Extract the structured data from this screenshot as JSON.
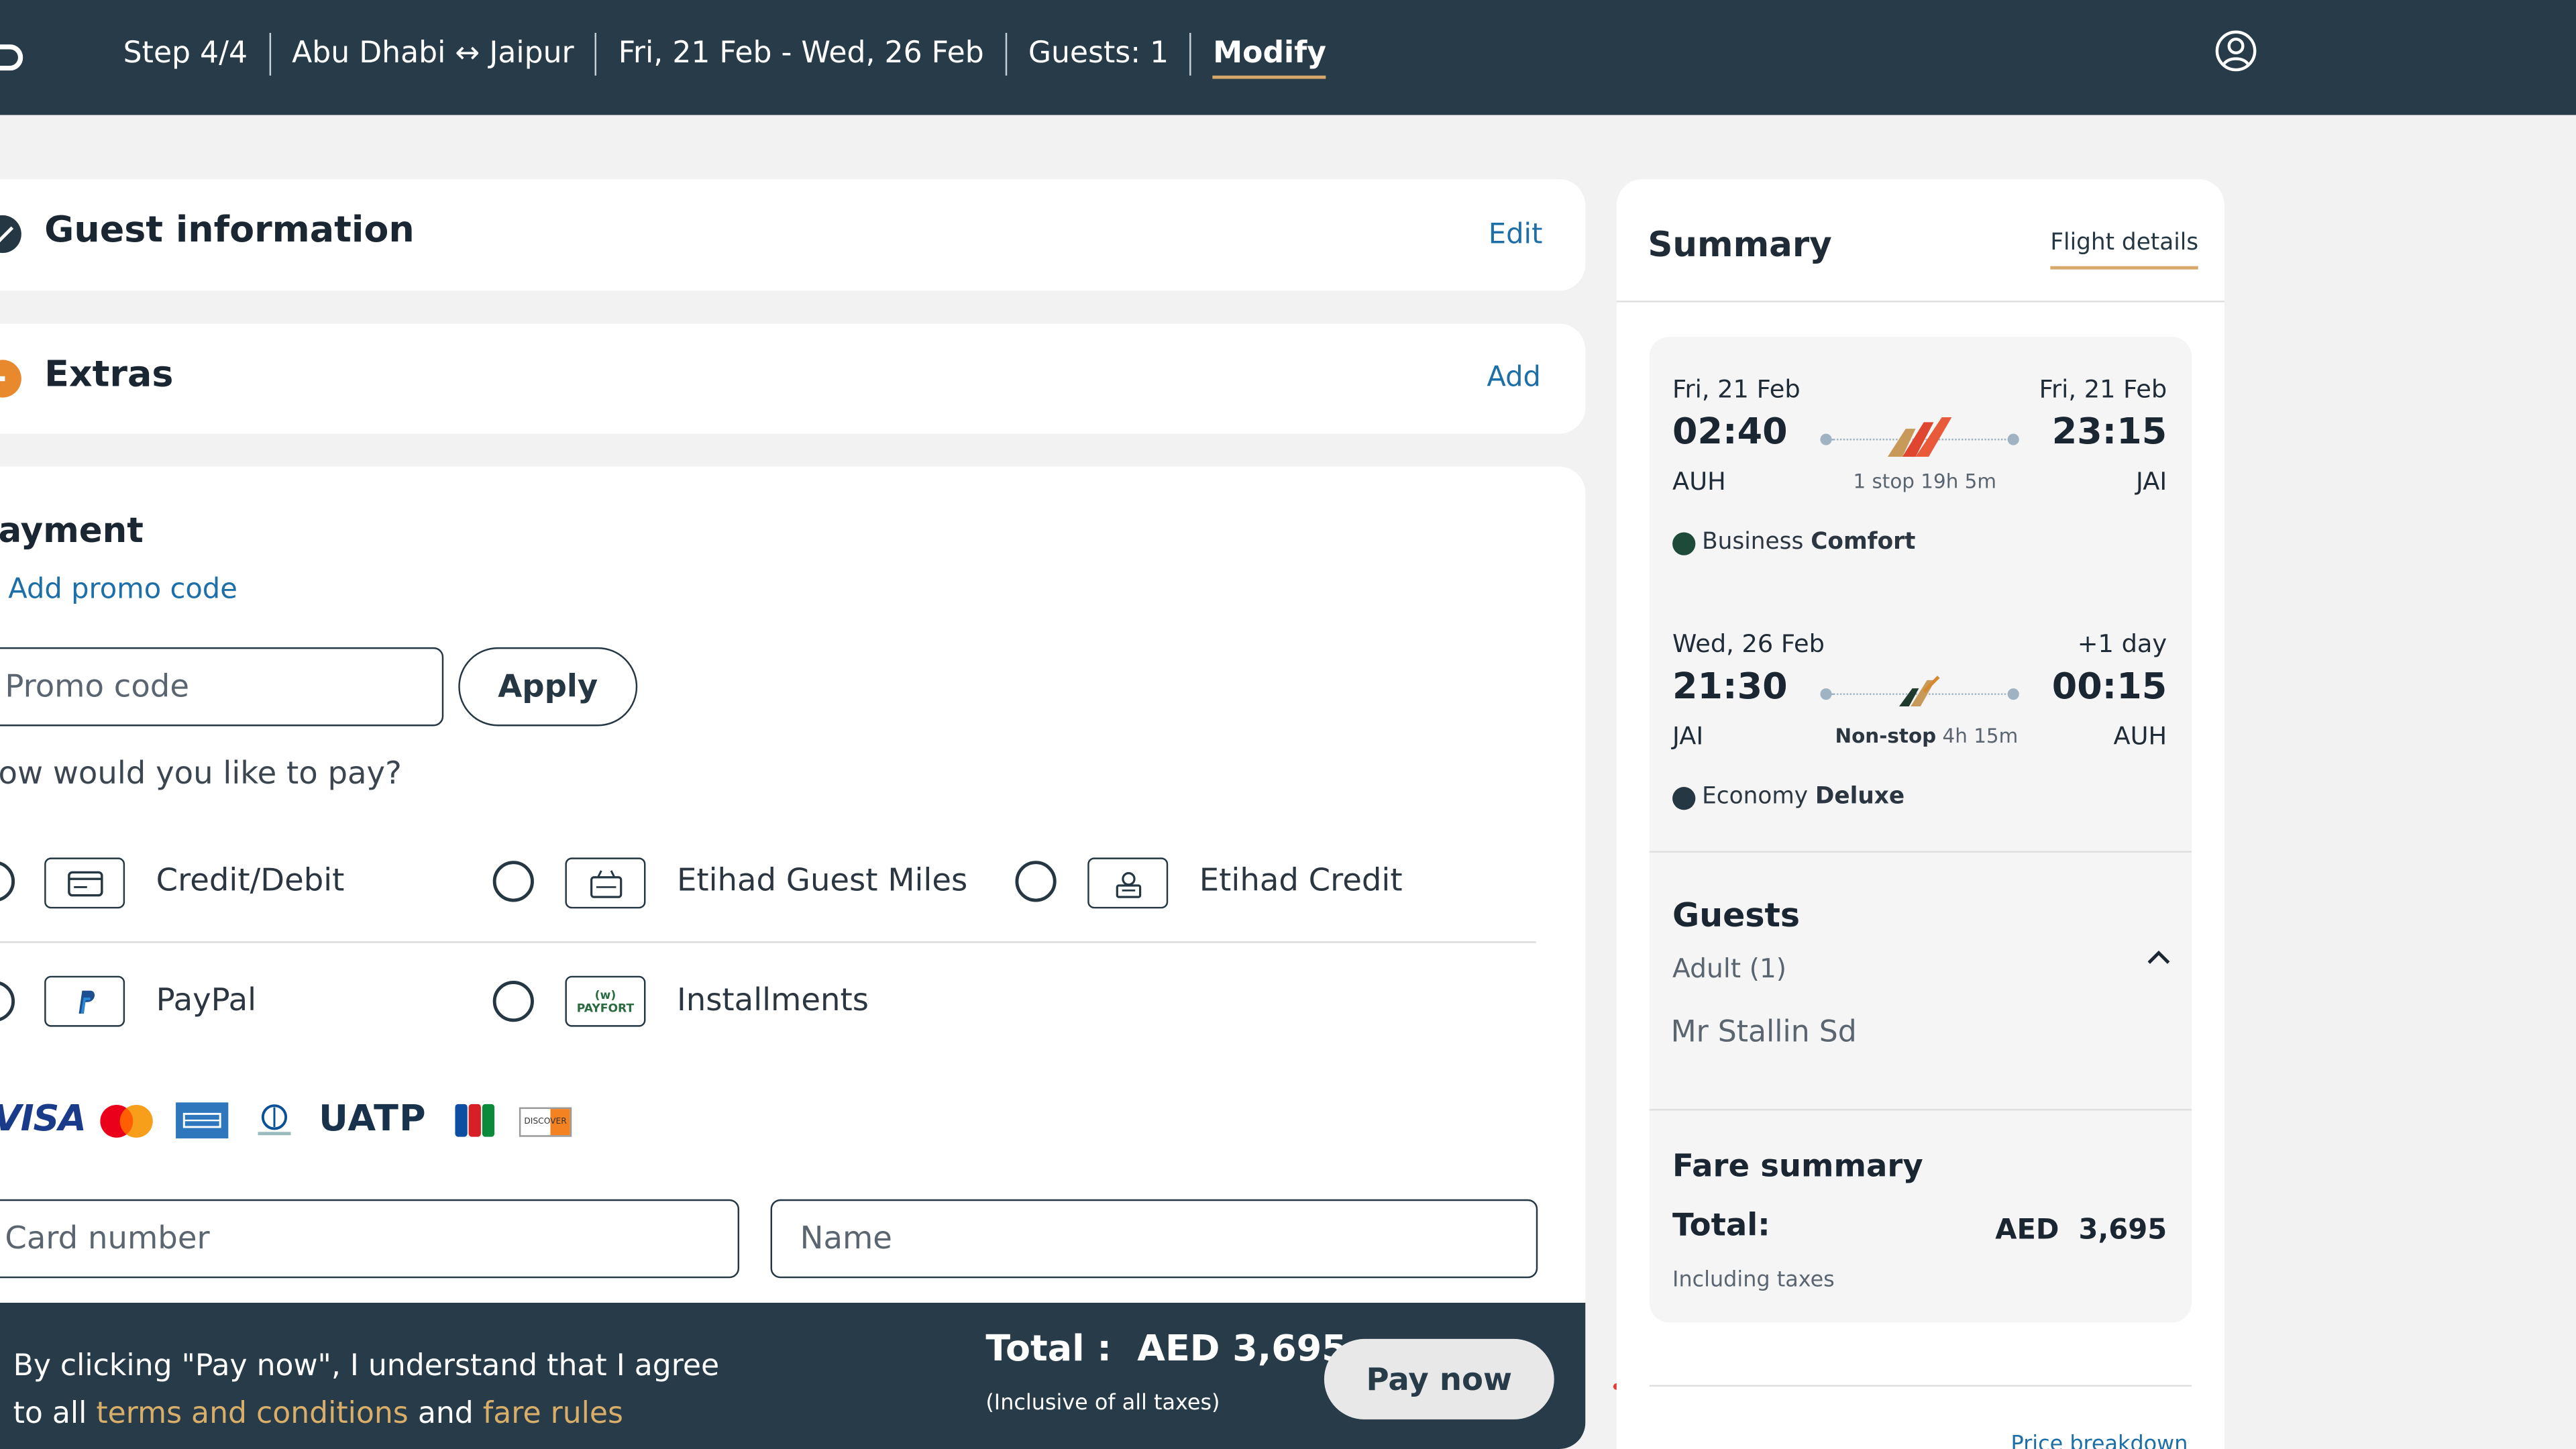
{
  "header": {
    "step": "Step 4/4",
    "route": "Abu Dhabi ↔ Jaipur",
    "dates": "Fri, 21 Feb - Wed, 26 Feb",
    "guests": "Guests: 1",
    "modify": "Modify"
  },
  "guest_info": {
    "title": "Guest information",
    "action": "Edit"
  },
  "extras": {
    "title": "Extras",
    "action": "Add"
  },
  "payment": {
    "title": "ayment",
    "promo_link": "Add promo code",
    "promo_placeholder": "Promo code",
    "apply_label": "Apply",
    "question": "ow would you like to pay?",
    "methods": [
      {
        "label": "Credit/Debit",
        "icon": "credit-card-icon"
      },
      {
        "label": "Etihad Guest Miles",
        "icon": "miles-icon"
      },
      {
        "label": "Etihad Credit",
        "icon": "etihad-credit-icon"
      },
      {
        "label": "PayPal",
        "icon": "paypal-icon"
      },
      {
        "label": "Installments",
        "icon": "payfort-icon"
      }
    ],
    "brands": {
      "visa": "VISA",
      "uatp": "UATP",
      "discover": "DISCOVER",
      "payfort": "PAYFORT"
    },
    "card_number_placeholder": "Card number",
    "name_placeholder": "Name"
  },
  "paybar": {
    "agree_prefix": "By clicking \"Pay now\", I understand that I agree",
    "agree_line2_prefix": "to all ",
    "terms_link": "terms and conditions",
    "and": " and ",
    "fare_rules_link": "fare rules",
    "total_label": "Total :",
    "total_value": "AED 3,695",
    "inclusive": "(Inclusive of all taxes)",
    "pay_now": "Pay now"
  },
  "summary": {
    "title": "Summary",
    "flight_details_tab": "Flight details",
    "outbound": {
      "dep_date": "Fri, 21 Feb",
      "dep_time": "02:40",
      "dep_code": "AUH",
      "arr_date": "Fri, 21 Feb",
      "arr_time": "23:15",
      "arr_code": "JAI",
      "stops": "1 stop 19h 5m",
      "cabin_prefix": "Business ",
      "cabin_suffix": "Comfort"
    },
    "inbound": {
      "dep_date": "Wed, 26 Feb",
      "dep_time": "21:30",
      "dep_code": "JAI",
      "arr_date": "+1 day",
      "arr_time": "00:15",
      "arr_code": "AUH",
      "stops_strong": "Non-stop",
      "stops_duration": " 4h 15m",
      "cabin_prefix": "Economy ",
      "cabin_suffix": "Deluxe"
    },
    "guests": {
      "title": "Guests",
      "type": "Adult (1)",
      "name": "Mr Stallin Sd"
    },
    "fare": {
      "title": "Fare summary",
      "total_label": "Total:",
      "currency": "AED",
      "amount": "3,695",
      "including": "Including taxes",
      "price_breakdown": "Price breakdown"
    }
  },
  "colors": {
    "header_bg": "#273b49",
    "accent_gold": "#d9ae69",
    "link_blue": "#1d6fa8",
    "extras_orange": "#e9892d"
  }
}
